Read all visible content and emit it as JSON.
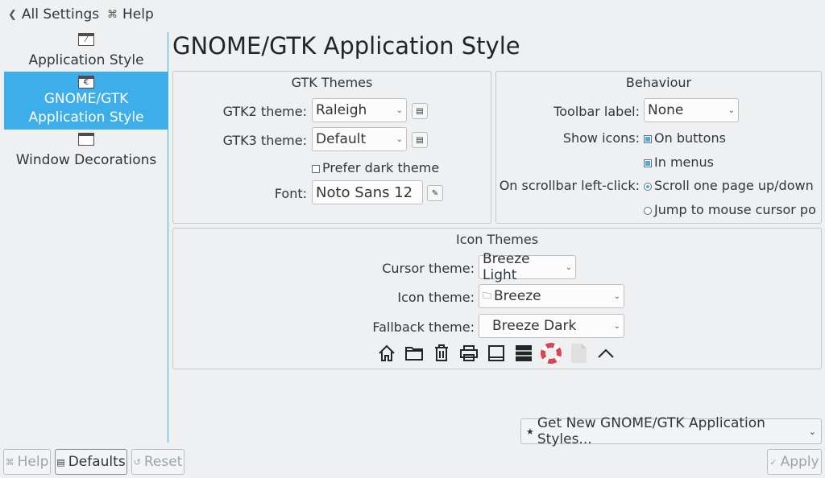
{
  "topbar": {
    "back_icon": "chevron-left-icon",
    "back_label": "All Settings",
    "help_icon": "help-icon",
    "help_label": "Help"
  },
  "sidebar": {
    "items": [
      {
        "label": "Application Style",
        "icon": "application-style-icon",
        "selected": false
      },
      {
        "label": "GNOME/GTK\nApplication Style",
        "icon": "gtk-style-icon",
        "selected": true
      },
      {
        "label": "Window Decorations",
        "icon": "window-decorations-icon",
        "selected": false
      }
    ]
  },
  "page": {
    "title": "GNOME/GTK Application Style"
  },
  "gtk_themes": {
    "title": "GTK Themes",
    "gtk2_label": "GTK2 theme:",
    "gtk2_value": "Raleigh",
    "gtk3_label": "GTK3 theme:",
    "gtk3_value": "Default",
    "prefer_dark_label": "Prefer dark theme",
    "prefer_dark_checked": false,
    "font_label": "Font:",
    "font_value": "Noto Sans 12"
  },
  "behaviour": {
    "title": "Behaviour",
    "toolbar_label": "Toolbar label:",
    "toolbar_value": "None",
    "show_icons_label": "Show icons:",
    "on_buttons_label": "On buttons",
    "on_buttons_checked": true,
    "in_menus_label": "In menus",
    "in_menus_checked": true,
    "scrollbar_label": "On scrollbar left-click:",
    "scroll_page_label": "Scroll one page up/down",
    "scroll_page_selected": true,
    "jump_label": "Jump to mouse cursor po",
    "jump_selected": false
  },
  "icon_themes": {
    "title": "Icon Themes",
    "cursor_label": "Cursor theme:",
    "cursor_value": "Breeze Light",
    "icon_label": "Icon theme:",
    "icon_value": "Breeze",
    "fallback_label": "Fallback theme:",
    "fallback_value": "Breeze Dark",
    "preview_icons": [
      "home-icon",
      "folder-icon",
      "trash-icon",
      "printer-icon",
      "monitor-icon",
      "server-icon",
      "help-lifebuoy-icon",
      "document-icon",
      "chevron-up-icon"
    ]
  },
  "get_new": {
    "label": "Get New GNOME/GTK Application Styles...",
    "icon": "star-icon"
  },
  "footer": {
    "help_label": "Help",
    "defaults_label": "Defaults",
    "reset_label": "Reset",
    "apply_label": "Apply"
  },
  "colors": {
    "accent": "#3daee9",
    "window_bg": "#eff0f1",
    "text": "#31363b"
  }
}
